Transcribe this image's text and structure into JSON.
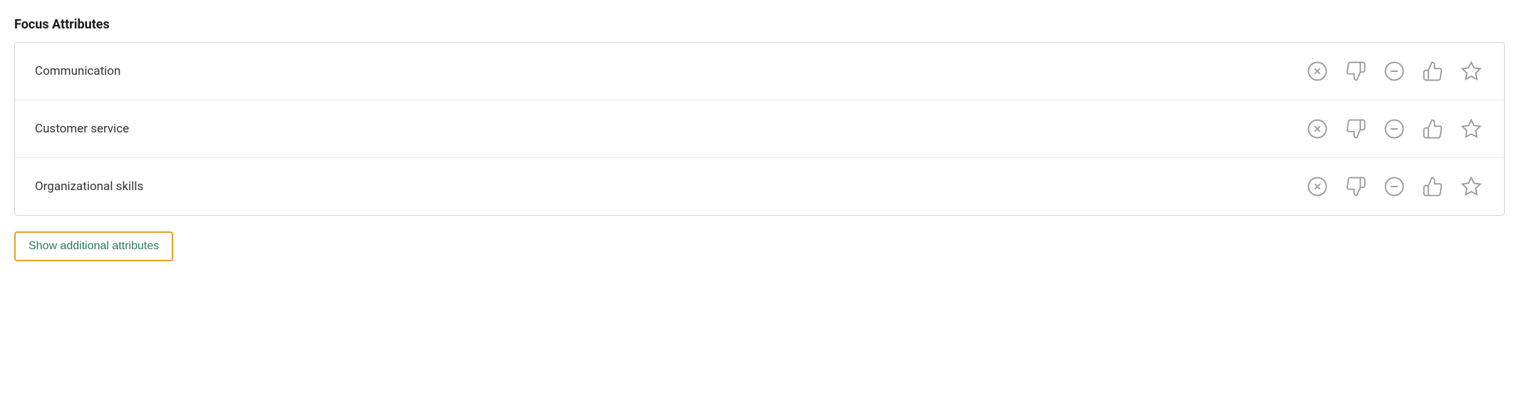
{
  "section": {
    "title": "Focus Attributes"
  },
  "attributes": [
    {
      "id": 1,
      "name": "Communication"
    },
    {
      "id": 2,
      "name": "Customer service"
    },
    {
      "id": 3,
      "name": "Organizational skills"
    }
  ],
  "actions": [
    {
      "name": "remove",
      "icon": "x-circle"
    },
    {
      "name": "thumbs-down",
      "icon": "thumbs-down"
    },
    {
      "name": "minus",
      "icon": "minus-circle"
    },
    {
      "name": "thumbs-up",
      "icon": "thumbs-up"
    },
    {
      "name": "star",
      "icon": "star"
    }
  ],
  "show_additional_button": {
    "label": "Show additional attributes"
  }
}
